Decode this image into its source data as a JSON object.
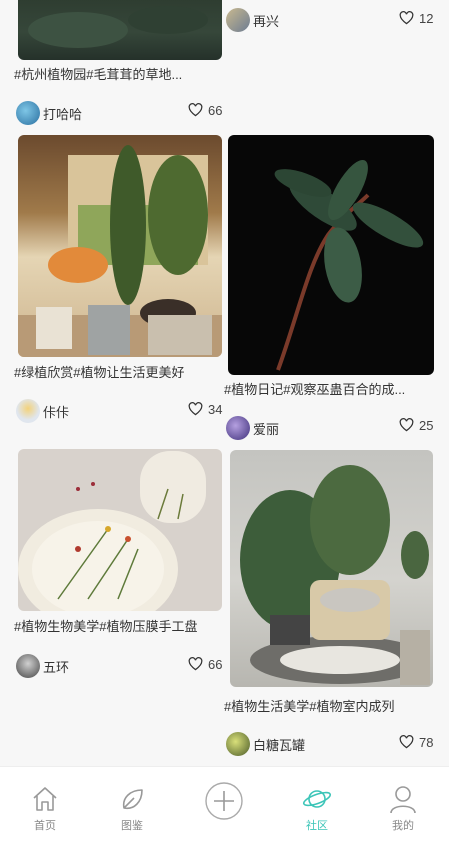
{
  "feed": {
    "top_left": {
      "caption": "#杭州植物园#毛茸茸的草地...",
      "author": "打哈哈",
      "likes": "66"
    },
    "top_right": {
      "author": "再兴",
      "likes": "12"
    },
    "card_2": {
      "caption": "#绿植欣赏#植物让生活更美好",
      "author": "佧佧",
      "likes": "34"
    },
    "card_3": {
      "caption": "#植物日记#观察巫蛊百合的成...",
      "author": "爱丽",
      "likes": "25"
    },
    "card_4": {
      "caption": "#植物生物美学#植物压膜手工盘",
      "author": "五环",
      "likes": "66"
    },
    "card_5": {
      "caption": "#植物生活美学#植物室内成列",
      "author": "白糖瓦罐",
      "likes": "78"
    }
  },
  "tabbar": {
    "home": "首页",
    "guide": "图鉴",
    "community": "社区",
    "mine": "我的"
  },
  "colors": {
    "accent": "#3cc5b8",
    "inactive": "#999999"
  }
}
